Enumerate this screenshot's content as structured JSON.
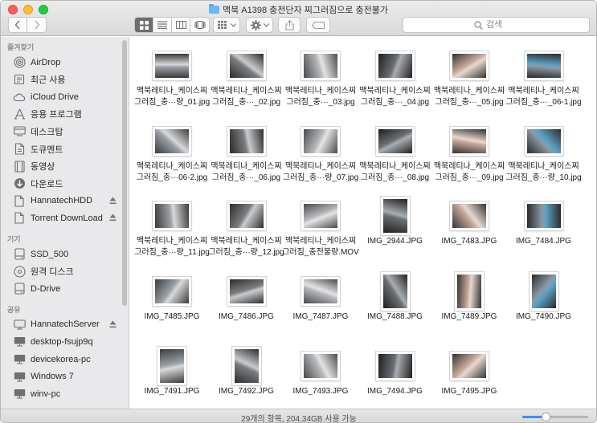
{
  "window": {
    "title": "맥북 A1398 충전단자 찌그러짐으로 충전불가"
  },
  "toolbar": {
    "back_icon": "chevron-left-icon",
    "forward_icon": "chevron-right-icon",
    "view_modes": [
      "icon-view",
      "list-view",
      "column-view",
      "coverflow-view"
    ],
    "active_view": "icon-view",
    "search_placeholder": "검색"
  },
  "sidebar": {
    "sections": [
      {
        "header": "즐겨찾기",
        "items": [
          {
            "label": "AirDrop",
            "icon": "airdrop-icon"
          },
          {
            "label": "최근 사용",
            "icon": "recents-icon"
          },
          {
            "label": "iCloud Drive",
            "icon": "cloud-icon"
          },
          {
            "label": "응용 프로그램",
            "icon": "applications-icon"
          },
          {
            "label": "데스크탑",
            "icon": "desktop-icon"
          },
          {
            "label": "도큐멘트",
            "icon": "document-icon"
          },
          {
            "label": "동영상",
            "icon": "movie-icon"
          },
          {
            "label": "다운로드",
            "icon": "download-icon"
          },
          {
            "label": "HannatechHDD",
            "icon": "file-icon",
            "eject": true
          },
          {
            "label": "Torrent DownLoad",
            "icon": "file-icon",
            "eject": true
          }
        ]
      },
      {
        "header": "기기",
        "items": [
          {
            "label": "SSD_500",
            "icon": "drive-icon"
          },
          {
            "label": "원격 디스크",
            "icon": "remote-disc-icon"
          },
          {
            "label": "D-Drive",
            "icon": "drive-icon"
          }
        ]
      },
      {
        "header": "공유",
        "items": [
          {
            "label": "HannatechServer",
            "icon": "server-icon",
            "eject": true
          },
          {
            "label": "desktop-fsujp9q",
            "icon": "monitor-icon"
          },
          {
            "label": "devicekorea-pc",
            "icon": "monitor-icon"
          },
          {
            "label": "Windows 7",
            "icon": "monitor-icon"
          },
          {
            "label": "winv-pc",
            "icon": "monitor-icon"
          }
        ]
      }
    ]
  },
  "files": [
    {
      "line1": "맥북레티나_케이스찌",
      "line2": "그러짐_충···량_01.jpg",
      "orient": "land"
    },
    {
      "line1": "맥북레티나_케이스찌",
      "line2": "그러짐_충···_02.jpg",
      "orient": "land"
    },
    {
      "line1": "맥북레티나_케이스찌",
      "line2": "그러짐_충···_03.jpg",
      "orient": "land"
    },
    {
      "line1": "맥북레티나_케이스찌",
      "line2": "그러짐_충···_04.jpg",
      "orient": "land"
    },
    {
      "line1": "맥북레티나_케이스찌",
      "line2": "그러짐_충···_05.jpg",
      "orient": "land"
    },
    {
      "line1": "맥북레티나_케이스찌",
      "line2": "그러짐_충···_06-1.jpg",
      "orient": "land"
    },
    {
      "line1": "맥북레티나_케이스찌",
      "line2": "그러짐_충···06-2.jpg",
      "orient": "land"
    },
    {
      "line1": "맥북레티나_케이스찌",
      "line2": "그러짐_충···_06.jpg",
      "orient": "land"
    },
    {
      "line1": "맥북레티나_케이스찌",
      "line2": "그러짐_충···량_07.jpg",
      "orient": "land"
    },
    {
      "line1": "맥북레티나_케이스찌",
      "line2": "그러짐_충···_08.jpg",
      "orient": "land"
    },
    {
      "line1": "맥북레티나_케이스찌",
      "line2": "그러짐_충···_09.jpg",
      "orient": "land"
    },
    {
      "line1": "맥북레티나_케이스찌",
      "line2": "그러짐_충···량_10.jpg",
      "orient": "land"
    },
    {
      "line1": "맥북레티나_케이스찌",
      "line2": "그러짐_충···량_11.jpg",
      "orient": "land"
    },
    {
      "line1": "맥북레티나_케이스찌",
      "line2": "그러짐_충···량_12.jpg",
      "orient": "land"
    },
    {
      "line1": "맥북레티나_케이스찌",
      "line2": "그러짐_충전불량.MOV",
      "orient": "land"
    },
    {
      "line1": "IMG_2944.JPG",
      "line2": "",
      "orient": "port"
    },
    {
      "line1": "IMG_7483.JPG",
      "line2": "",
      "orient": "land"
    },
    {
      "line1": "IMG_7484.JPG",
      "line2": "",
      "orient": "land"
    },
    {
      "line1": "IMG_7485.JPG",
      "line2": "",
      "orient": "land"
    },
    {
      "line1": "IMG_7486.JPG",
      "line2": "",
      "orient": "land"
    },
    {
      "line1": "IMG_7487.JPG",
      "line2": "",
      "orient": "land"
    },
    {
      "line1": "IMG_7488.JPG",
      "line2": "",
      "orient": "port"
    },
    {
      "line1": "IMG_7489.JPG",
      "line2": "",
      "orient": "port"
    },
    {
      "line1": "IMG_7490.JPG",
      "line2": "",
      "orient": "port"
    },
    {
      "line1": "IMG_7491.JPG",
      "line2": "",
      "orient": "port"
    },
    {
      "line1": "IMG_7492.JPG",
      "line2": "",
      "orient": "port"
    },
    {
      "line1": "IMG_7493.JPG",
      "line2": "",
      "orient": "land"
    },
    {
      "line1": "IMG_7494.JPG",
      "line2": "",
      "orient": "land"
    },
    {
      "line1": "IMG_7495.JPG",
      "line2": "",
      "orient": "land"
    }
  ],
  "statusbar": {
    "text": "29개의 항목, 204.34GB 사용 가능",
    "zoom_fraction": 0.35
  },
  "colors": {
    "accent": "#3f8ef6",
    "sidebar_bg": "#e9e8ea"
  }
}
